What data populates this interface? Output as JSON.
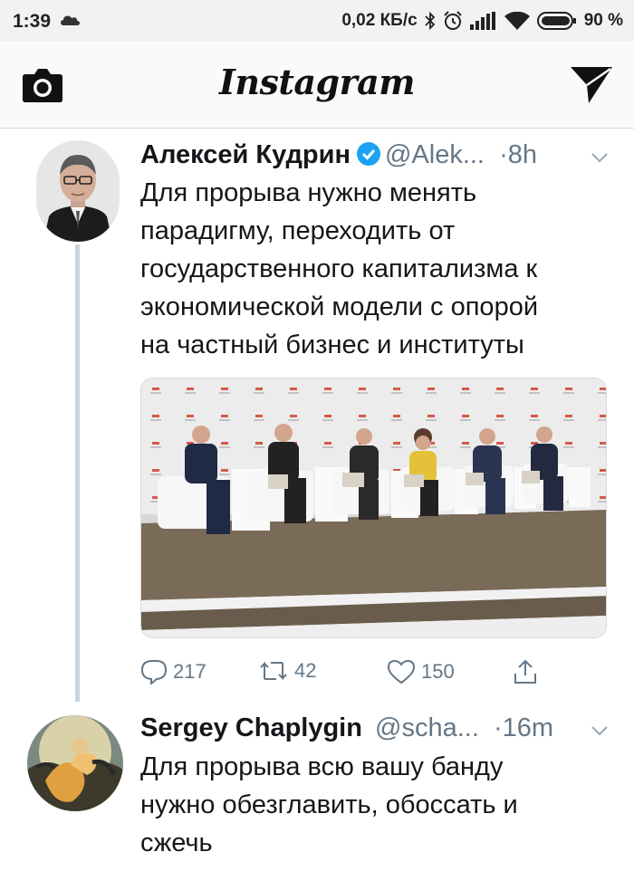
{
  "status_bar": {
    "time": "1:39",
    "network_speed": "0,02 КБ/с",
    "battery": "90 %"
  },
  "app": {
    "title": "Instagram",
    "camera_icon": "camera-icon",
    "direct_icon": "send-icon"
  },
  "tweets": [
    {
      "author_name": "Алексей Кудрин",
      "verified": true,
      "handle": "@Alek...",
      "time": "·8h",
      "text_lines": [
        "Для прорыва нужно менять",
        "парадигму, переходить от",
        "государственного капитализма к",
        "экономической модели с опорой",
        "на частный бизнес и институты"
      ],
      "has_photo": true,
      "replies": "217",
      "retweets": "42",
      "likes": "150"
    },
    {
      "author_name": "Sergey Chaplygin",
      "verified": false,
      "handle": "@scha...",
      "time": "·16m",
      "text_lines": [
        "Для прорыва всю вашу банду",
        "нужно обезглавить, обоссать и",
        "сжечь"
      ]
    }
  ],
  "colors": {
    "text": "#14171a",
    "secondary": "#657786",
    "verified": "#1da1f2",
    "thread_line": "#c7d5e0"
  }
}
